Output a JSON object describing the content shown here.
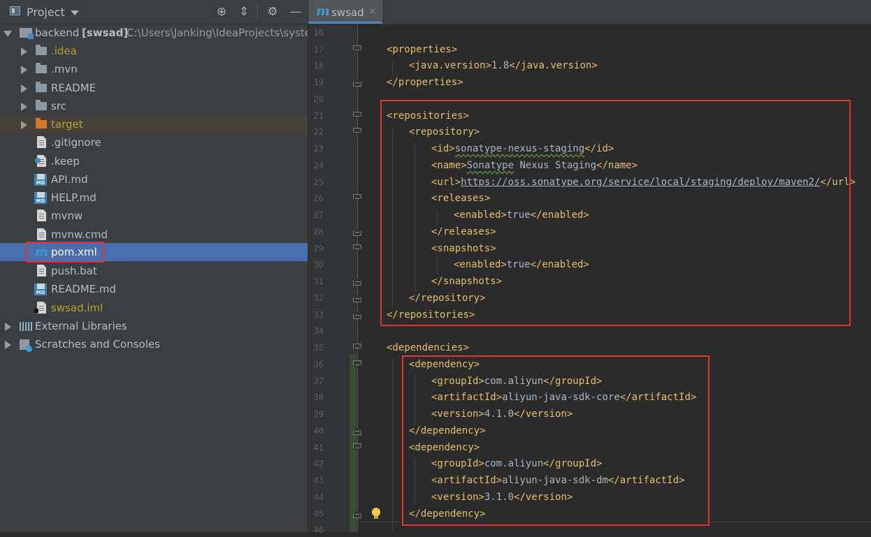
{
  "project_panel": {
    "title": "Project",
    "root": {
      "name": "backend",
      "module": "[swsad]",
      "path": "C:\\Users\\Janking\\IdeaProjects\\syste"
    },
    "items": [
      {
        "label": ".idea",
        "type": "folder",
        "color": "#b8a034"
      },
      {
        "label": ".mvn",
        "type": "folder"
      },
      {
        "label": "README",
        "type": "folder"
      },
      {
        "label": "src",
        "type": "folder"
      },
      {
        "label": "target",
        "type": "excluded-folder",
        "color": "#b8a034"
      },
      {
        "label": ".gitignore",
        "type": "file"
      },
      {
        "label": ".keep",
        "type": "file"
      },
      {
        "label": "API.md",
        "type": "markdown"
      },
      {
        "label": "HELP.md",
        "type": "markdown"
      },
      {
        "label": "mvnw",
        "type": "file"
      },
      {
        "label": "mvnw.cmd",
        "type": "file"
      },
      {
        "label": "pom.xml",
        "type": "maven",
        "selected": true
      },
      {
        "label": "push.bat",
        "type": "file"
      },
      {
        "label": "README.md",
        "type": "markdown"
      },
      {
        "label": "swsad.iml",
        "type": "iml",
        "color": "#b8a034"
      }
    ],
    "external_libraries": "External Libraries",
    "scratches": "Scratches and Consoles"
  },
  "editor": {
    "tab": {
      "label": "swsad",
      "close": "×"
    },
    "line_numbers": [
      "16",
      "17",
      "18",
      "19",
      "20",
      "21",
      "22",
      "23",
      "24",
      "25",
      "26",
      "27",
      "28",
      "29",
      "30",
      "31",
      "32",
      "33",
      "34",
      "35",
      "36",
      "37",
      "38",
      "39",
      "40",
      "41",
      "42",
      "43",
      "44",
      "45",
      "46"
    ],
    "lines": {
      "l17": "<properties>",
      "l18_open": "<java.version>",
      "l18_val": "1.8",
      "l18_close": "</java.version>",
      "l19": "</properties>",
      "l21": "<repositories>",
      "l22": "<repository>",
      "l23_open": "<id>",
      "l23_val": "sonatype-nexus-staging",
      "l23_close": "</id>",
      "l24_open": "<name>",
      "l24_val_a": "Sonatype",
      "l24_val_b": " Nexus Staging",
      "l24_close": "</name>",
      "l25_open": "<url>",
      "l25_val": "https://oss.sonatype.org/service/local/staging/deploy/maven2/",
      "l25_close": "</url>",
      "l26": "<releases>",
      "l27_open": "<enabled>",
      "l27_val": "true",
      "l27_close": "</enabled>",
      "l28": "</releases>",
      "l29": "<snapshots>",
      "l30_open": "<enabled>",
      "l30_val": "true",
      "l30_close": "</enabled>",
      "l31": "</snapshots>",
      "l32": "</repository>",
      "l33": "</repositories>",
      "l35": "<dependencies>",
      "l36": "<dependency>",
      "l37_open": "<groupId>",
      "l37_val": "com.aliyun",
      "l37_close": "</groupId>",
      "l38_open": "<artifactId>",
      "l38_val": "aliyun-java-sdk-core",
      "l38_close": "</artifactId>",
      "l39_open": "<version>",
      "l39_val": "4.1.0",
      "l39_close": "</version>",
      "l40": "</dependency>",
      "l41": "<dependency>",
      "l42_open": "<groupId>",
      "l42_val": "com.aliyun",
      "l42_close": "</groupId>",
      "l43_open": "<artifactId>",
      "l43_val": "aliyun-java-sdk-dm",
      "l43_close": "</artifactId>",
      "l44_open": "<version>",
      "l44_val": "3.1.0",
      "l44_close": "</version>",
      "l45": "</dependency>"
    }
  },
  "colors": {
    "tag": "#e8bf6a",
    "text": "#a9b7c6",
    "selection": "#4b6eaf",
    "highlight_box": "#e33232",
    "panel_bg": "#3c3f41",
    "editor_bg": "#2b2b2b"
  },
  "icons": [
    "project-view-icon",
    "locate-icon",
    "collapse-all-icon",
    "settings-gear-icon",
    "hide-panel-icon",
    "maven-m-icon",
    "folder-icon",
    "file-icon",
    "markdown-icon",
    "library-icon",
    "scratch-icon",
    "lightbulb-icon"
  ]
}
